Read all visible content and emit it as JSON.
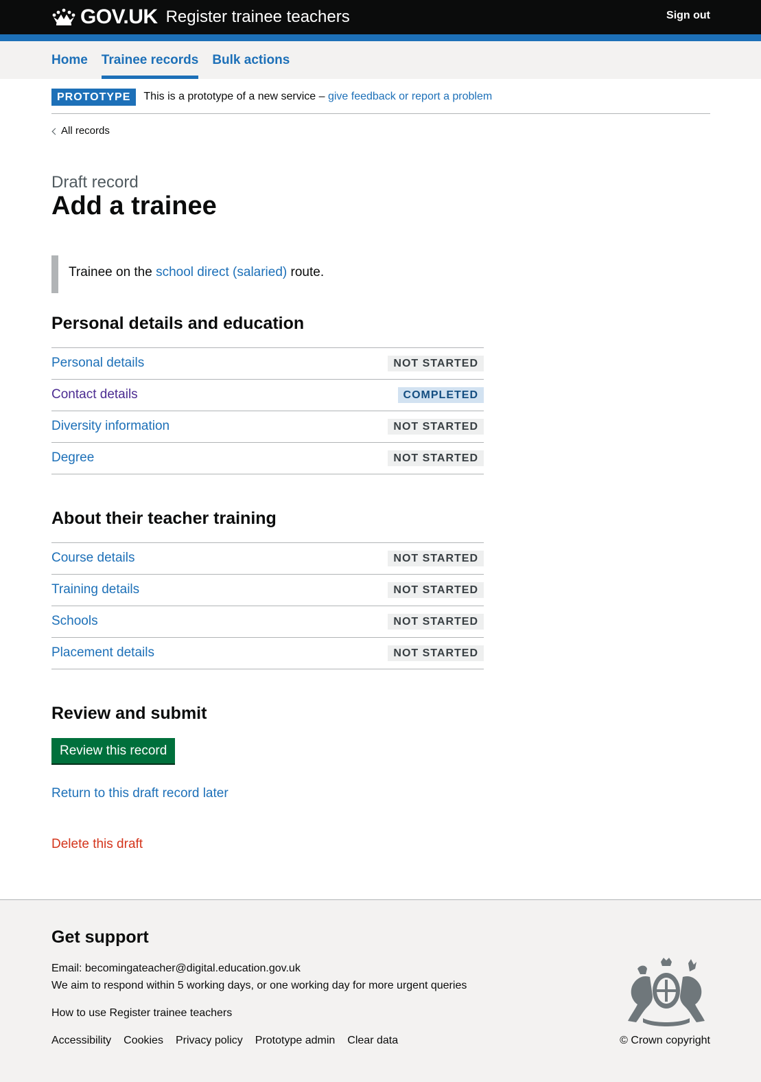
{
  "header": {
    "logo_text": "GOV.UK",
    "service_name": "Register trainee teachers",
    "sign_out": "Sign out"
  },
  "nav": {
    "items": [
      {
        "label": "Home",
        "current": false
      },
      {
        "label": "Trainee records",
        "current": true
      },
      {
        "label": "Bulk actions",
        "current": false
      }
    ]
  },
  "phase_banner": {
    "tag": "PROTOTYPE",
    "text": "This is a prototype of a new service –",
    "link": "give feedback or report a problem"
  },
  "back_link": "All records",
  "page": {
    "caption": "Draft record",
    "title": "Add a trainee"
  },
  "inset": {
    "before": "Trainee on the",
    "link": "school direct (salaried)",
    "after": "route."
  },
  "sections": [
    {
      "heading": "Personal details and education",
      "tasks": [
        {
          "label": "Personal details",
          "status": "NOT STARTED"
        },
        {
          "label": "Contact details",
          "status": "COMPLETED"
        },
        {
          "label": "Diversity information",
          "status": "NOT STARTED"
        },
        {
          "label": "Degree",
          "status": "NOT STARTED"
        }
      ]
    },
    {
      "heading": "About their teacher training",
      "tasks": [
        {
          "label": "Course details",
          "status": "NOT STARTED"
        },
        {
          "label": "Training details",
          "status": "NOT STARTED"
        },
        {
          "label": "Schools",
          "status": "NOT STARTED"
        },
        {
          "label": "Placement details",
          "status": "NOT STARTED"
        }
      ]
    }
  ],
  "review": {
    "heading": "Review and submit",
    "button": "Review this record",
    "return_link": "Return to this draft record later",
    "delete_link": "Delete this draft"
  },
  "footer": {
    "heading": "Get support",
    "email_label": "Email:",
    "email": "becomingateacher@digital.education.gov.uk",
    "respond": "We aim to respond within 5 working days, or one working day for more urgent queries",
    "how_to": "How to use Register trainee teachers",
    "links": [
      "Accessibility",
      "Cookies",
      "Privacy policy",
      "Prototype admin",
      "Clear data"
    ],
    "copyright": "© Crown copyright"
  },
  "colors": {
    "link": "#1d70b8",
    "visited": "#4c2c92",
    "button": "#00703c",
    "warning": "#d4351c",
    "header": "#0b0c0c"
  },
  "icons": [
    "crown-icon",
    "chevron-left-icon",
    "royal-crest-icon"
  ]
}
